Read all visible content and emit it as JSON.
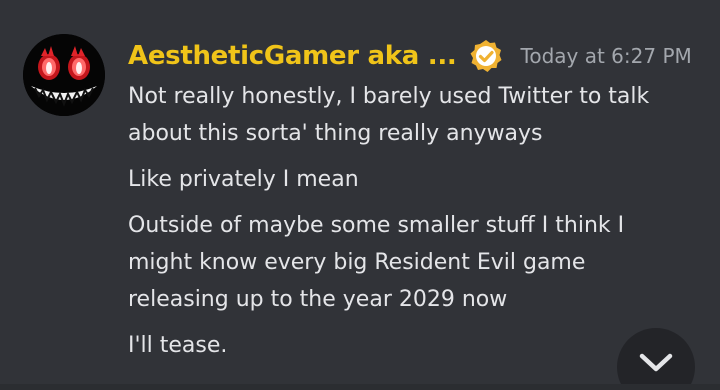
{
  "message": {
    "author": {
      "name": "AestheticGamer aka ...",
      "avatar_icon": "grinning-demon-face-avatar",
      "badge_icon": "verified-check-badge-icon",
      "name_color": "#f0c419"
    },
    "timestamp": "Today at 6:27 PM",
    "lines": [
      "Not really honestly, I barely used Twitter to talk\nabout this sorta' thing really anyways",
      "Like privately I mean",
      "Outside of maybe some smaller stuff I think I\nmight know every big Resident Evil game\nreleasing up to the year 2029 now",
      "I'll tease."
    ]
  },
  "scroll_button": {
    "icon": "chevron-down-icon"
  },
  "colors": {
    "background": "#313338",
    "text": "#e4e5e8",
    "timestamp": "#a3a7ad",
    "scroll_button_bg": "#232428"
  }
}
